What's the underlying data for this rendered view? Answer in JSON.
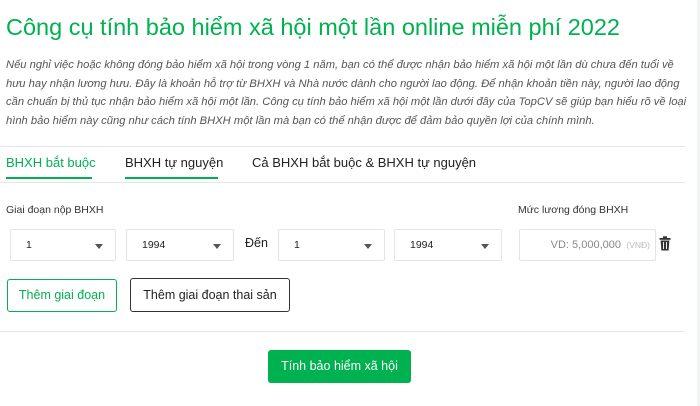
{
  "page": {
    "title": "Công cụ tính bảo hiểm xã hội một lần online miễn phí 2022",
    "intro": "Nếu nghỉ việc hoặc không đóng bảo hiểm xã hội trong vòng 1 năm, bạn có thể được nhận bảo hiểm xã hội một lần dù chưa đến tuổi về hưu hay nhận lương hưu. Đây là khoản hỗ trợ từ BHXH và Nhà nước dành cho người lao động. Để nhận khoản tiền này, người lao động cần chuẩn bị thủ tục nhận bảo hiểm xã hội một lần. Công cụ tính bảo hiểm xã hội một lần dưới đây của TopCV sẽ giúp bạn hiểu rõ về loại hình bảo hiểm này cũng như cách tính BHXH một lần mà bạn có thể nhận được để đảm bảo quyền lợi của chính mình."
  },
  "tabs": [
    {
      "label": "BHXH bắt buộc",
      "active": true
    },
    {
      "label": "BHXH tự nguyện",
      "active": false
    },
    {
      "label": "Cả BHXH bắt buộc & BHXH tự nguyện",
      "active": false
    }
  ],
  "form": {
    "period_label": "Giai đoạn nộp BHXH",
    "salary_label": "Mức lương đóng BHXH",
    "from_month": "1",
    "from_year": "1994",
    "to_label": "Đến",
    "to_month": "1",
    "to_year": "1994",
    "salary_placeholder": "VD: 5,000,000",
    "salary_unit": "(VNĐ)"
  },
  "buttons": {
    "add_period": "Thêm giai đoạn",
    "add_maternity": "Thêm giai đoạn thai sản",
    "calculate": "Tính bảo hiểm xã hội"
  },
  "colors": {
    "accent": "#00b14f",
    "background": "#f2f3f5",
    "text": "#333333"
  },
  "icons": {
    "select_caret": "caret-down-icon",
    "delete": "trash-icon"
  }
}
